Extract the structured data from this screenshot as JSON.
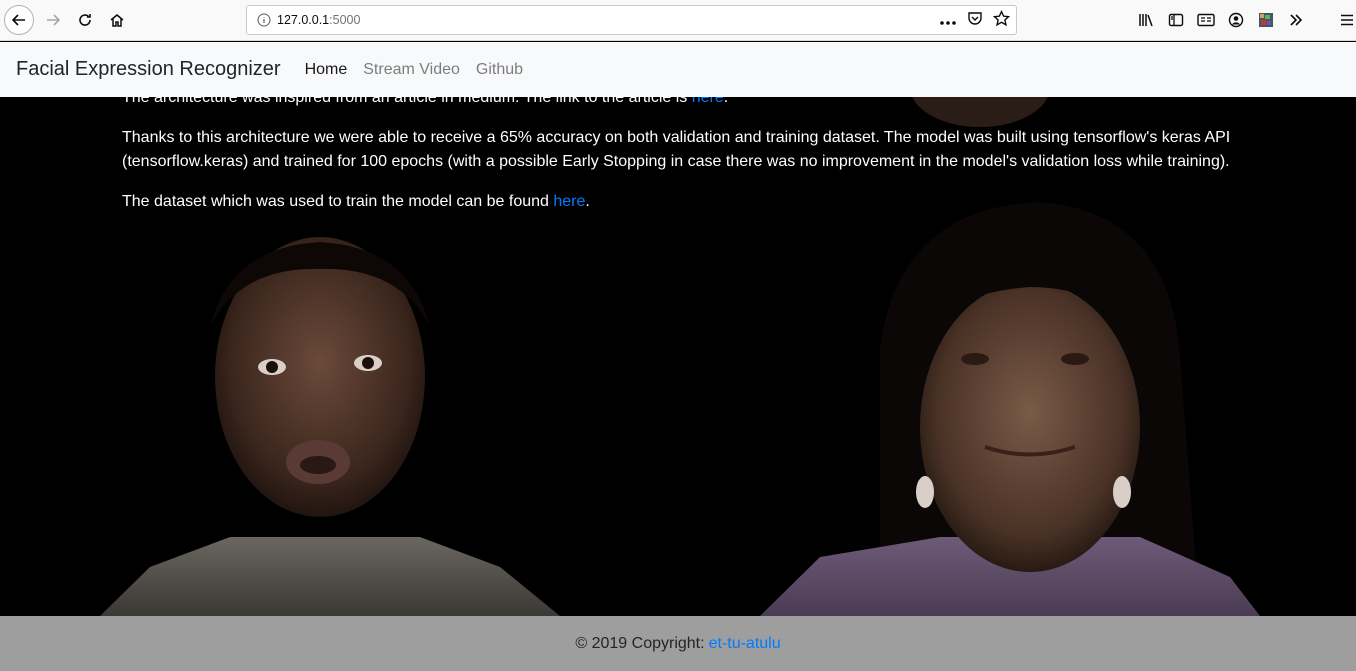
{
  "browser": {
    "url_host": "127.0.0.1",
    "url_port": ":5000",
    "icons": [
      "back-icon",
      "forward-icon",
      "reload-icon",
      "home-icon",
      "info-icon",
      "page-actions-icon",
      "pocket-icon",
      "bookmark-star-icon",
      "library-icon",
      "sidebar-icon",
      "reader-view-icon",
      "account-icon",
      "extension-icon",
      "overflow-icon",
      "menu-icon"
    ]
  },
  "navbar": {
    "brand": "Facial Expression Recognizer",
    "links": [
      {
        "label": "Home",
        "active": true
      },
      {
        "label": "Stream Video",
        "active": false
      },
      {
        "label": "Github",
        "active": false
      }
    ]
  },
  "content": {
    "p1_text": "The architecture was inspired from an article in medium. The link to the article is ",
    "p1_link": "here",
    "p1_end": ".",
    "p2_text": "Thanks to this architecture we were able to receive a 65% accuracy on both validation and training dataset. The model was built using tensorflow's keras API (tensorflow.keras) and trained for 100 epochs (with a possible Early Stopping in case there was no improvement in the model's validation loss while training).",
    "p3_text": "The dataset which was used to train the model can be found ",
    "p3_link": "here",
    "p3_end": "."
  },
  "footer": {
    "copyright": "© 2019 Copyright: ",
    "link": "et-tu-atulu"
  },
  "colors": {
    "link": "#007bff",
    "navbar_bg": "#f8f9fa",
    "footer_bg": "#9e9e9e",
    "content_bg": "#000000"
  }
}
